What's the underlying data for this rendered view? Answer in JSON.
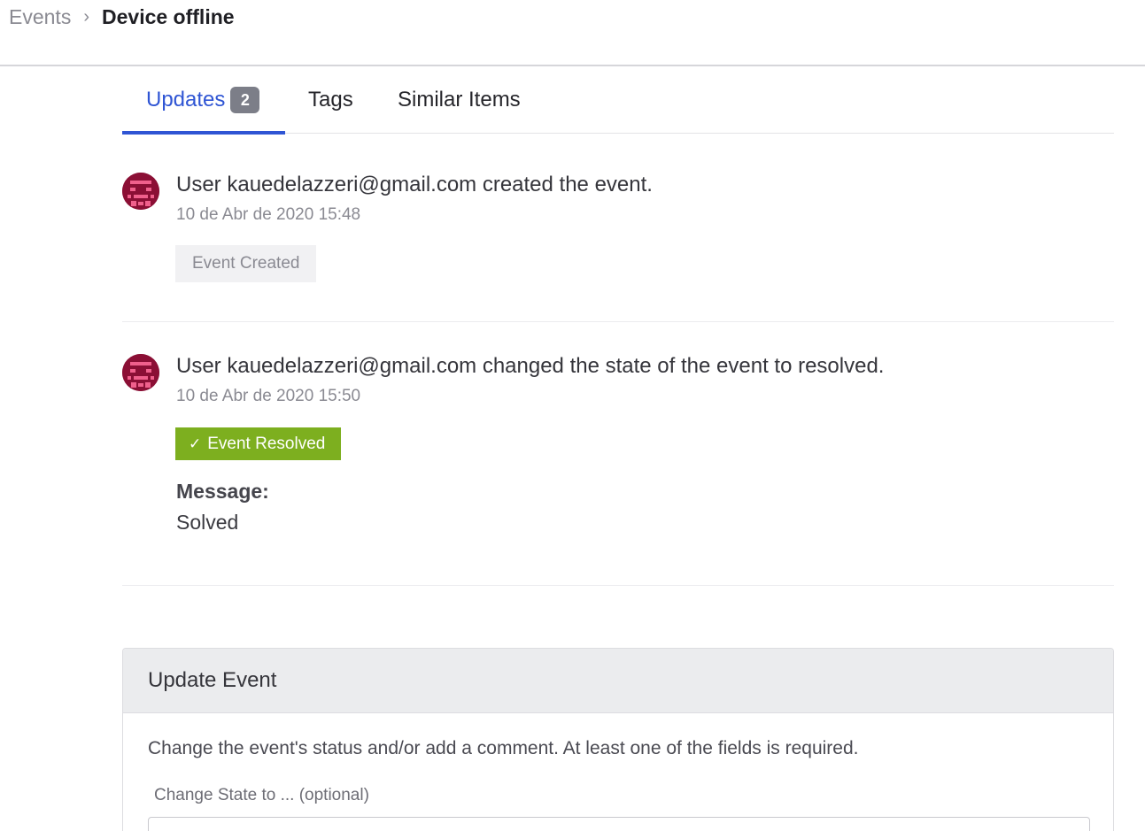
{
  "breadcrumb": {
    "parent": "Events",
    "separator": "›",
    "current": "Device offline"
  },
  "tabs": [
    {
      "label": "Updates",
      "badge": "2",
      "active": true
    },
    {
      "label": "Tags",
      "active": false
    },
    {
      "label": "Similar Items",
      "active": false
    }
  ],
  "updates": [
    {
      "text": "User kauedelazzeri@gmail.com created the event.",
      "timestamp": "10 de Abr de 2020 15:48",
      "tag": "Event Created"
    },
    {
      "text": "User kauedelazzeri@gmail.com changed the state of the event to resolved.",
      "timestamp": "10 de Abr de 2020 15:50",
      "tag": "Event Resolved",
      "tag_icon": "check-icon",
      "message_label": "Message:",
      "message_value": "Solved"
    }
  ],
  "update_event": {
    "title": "Update Event",
    "description": "Change the event's status and/or add a comment. At least one of the fields is required.",
    "state_label": "Change State to ... (optional)"
  },
  "colors": {
    "accent": "#2f55d4",
    "resolved": "#7daf1f",
    "avatar_bg": "#8b0f35",
    "avatar_fg": "#f0608c"
  }
}
